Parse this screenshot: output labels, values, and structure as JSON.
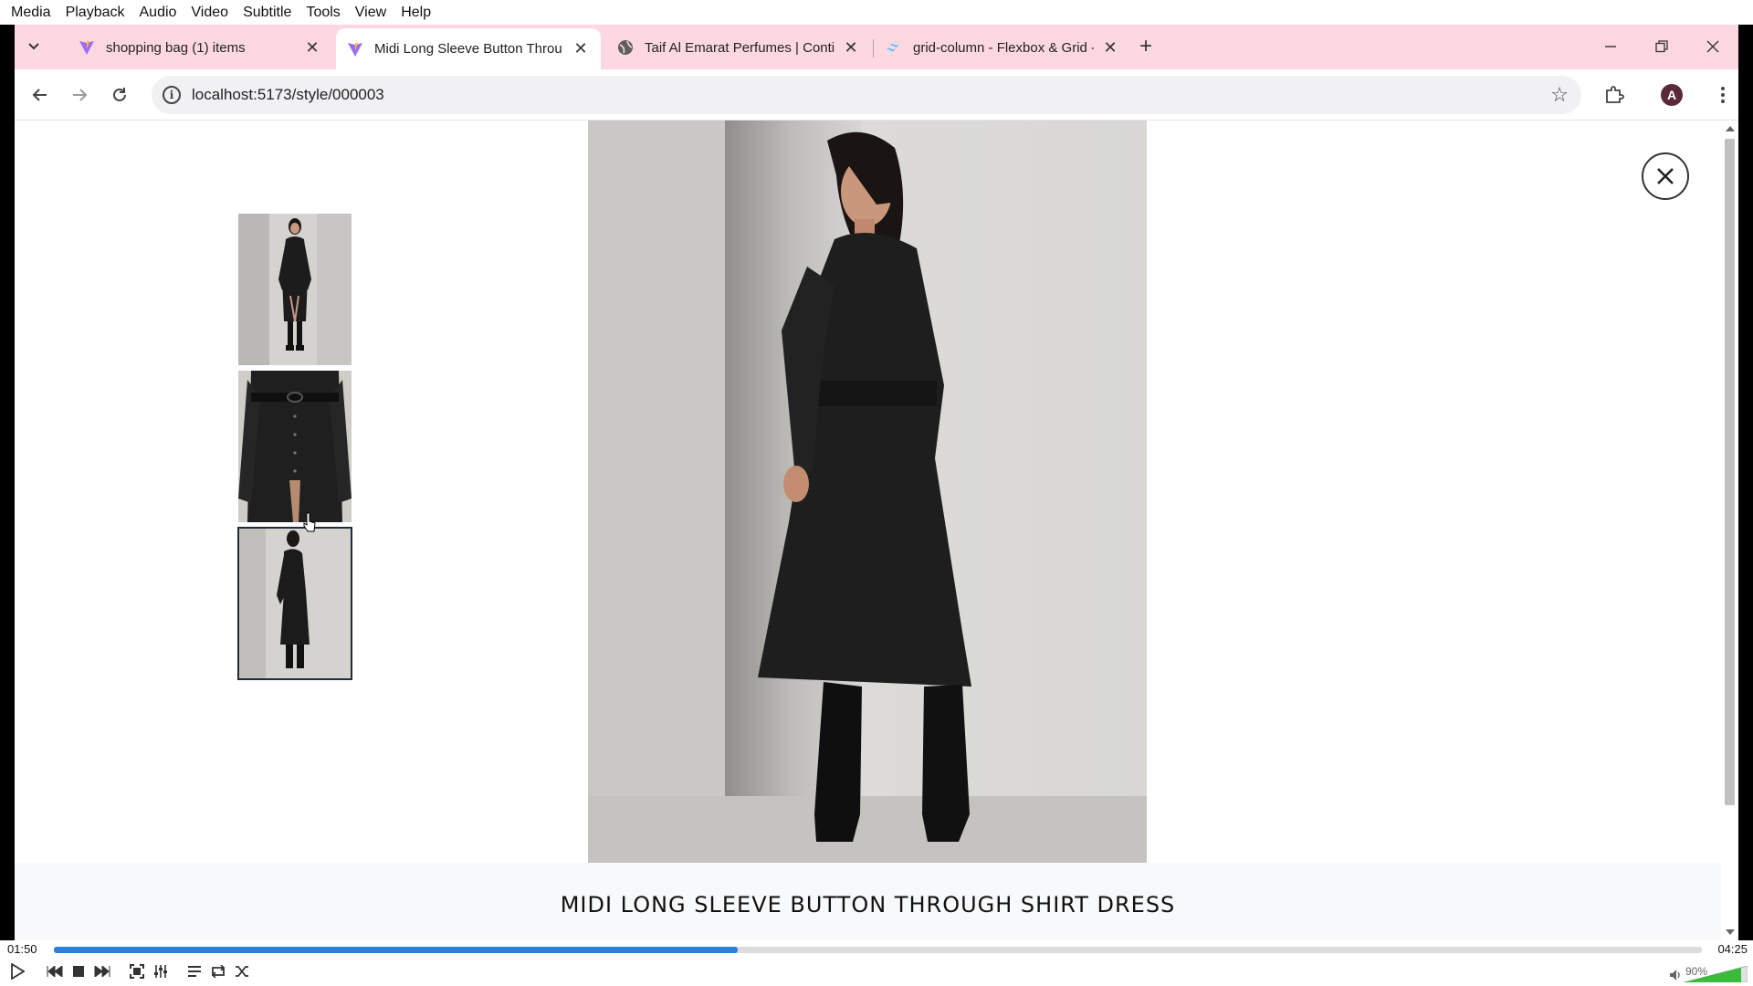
{
  "player": {
    "menu": [
      "Media",
      "Playback",
      "Audio",
      "Video",
      "Subtitle",
      "Tools",
      "View",
      "Help"
    ],
    "time_elapsed": "01:50",
    "time_total": "04:25",
    "progress_fraction": 0.415,
    "volume_label": "90%",
    "volume_fraction": 0.9,
    "accent_color": "#2b80d8"
  },
  "browser": {
    "tabs": [
      {
        "title": "shopping bag (1) items",
        "favicon": "vite-icon",
        "active": false
      },
      {
        "title": "Midi Long Sleeve Button Throu",
        "favicon": "vite-icon",
        "active": true
      },
      {
        "title": "Taif Al Emarat Perfumes | Contir",
        "favicon": "globe-icon",
        "active": false
      },
      {
        "title": "grid-column - Flexbox & Grid -",
        "favicon": "tailwind-icon",
        "active": false
      }
    ],
    "url": "localhost:5173/style/000003",
    "profile_initial": "A",
    "tab_strip_color": "#fdd8e0"
  },
  "page": {
    "product_title": "MIDI LONG SLEEVE BUTTON THROUGH SHIRT DRESS",
    "selected_thumbnail": 3
  }
}
